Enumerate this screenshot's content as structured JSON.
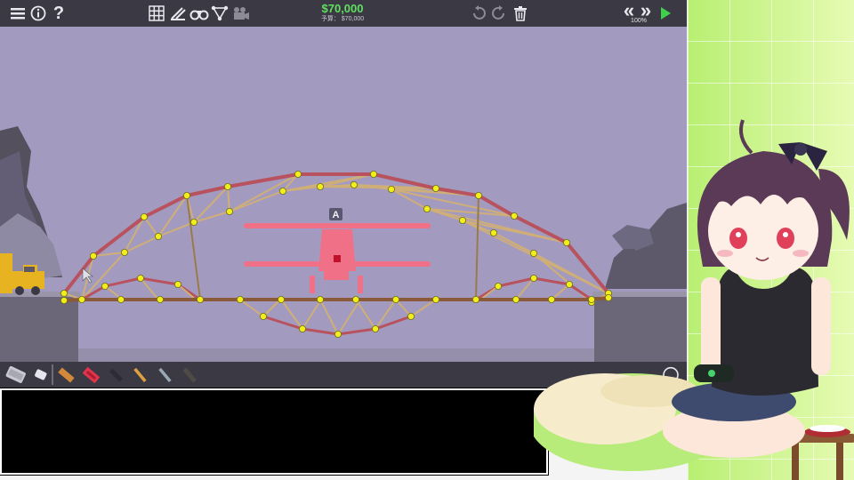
{
  "topbar": {
    "menu_icon": "hamburger-menu-icon",
    "info_icon": "info-icon",
    "help_label": "?",
    "grid_icon": "grid-icon",
    "stress_icon": "stress-view-icon",
    "binoculars_icon": "binoculars-icon",
    "joints_icon": "joints-icon",
    "camera_icon": "camera-icon",
    "money": "$70,000",
    "budget": "予算： $70,000",
    "undo_icon": "undo-icon",
    "redo_icon": "redo-icon",
    "trash_icon": "trash-icon",
    "rewind_label": "«",
    "fast_forward_label": "»",
    "speed_label": "100%",
    "play_icon": "play-icon"
  },
  "scene": {
    "vehicle_marker": "A",
    "colors": {
      "sky": "#a39bbf",
      "road": "#8a5a3a",
      "steel": "#b8525e",
      "wood": "#cfae78",
      "joint": "#f2ee1a",
      "plane": "#f07088",
      "truck": "#e8b320"
    }
  },
  "toolbar": {
    "tools": [
      "eraser-tool-icon",
      "small-eraser-tool-icon",
      "wood-material-icon",
      "road-material-icon",
      "reinforced-road-material-icon",
      "steel-material-icon",
      "rope-material-icon",
      "cable-material-icon"
    ],
    "rotate_icon": "rotate-view-icon"
  },
  "dialog": {
    "text": ""
  }
}
